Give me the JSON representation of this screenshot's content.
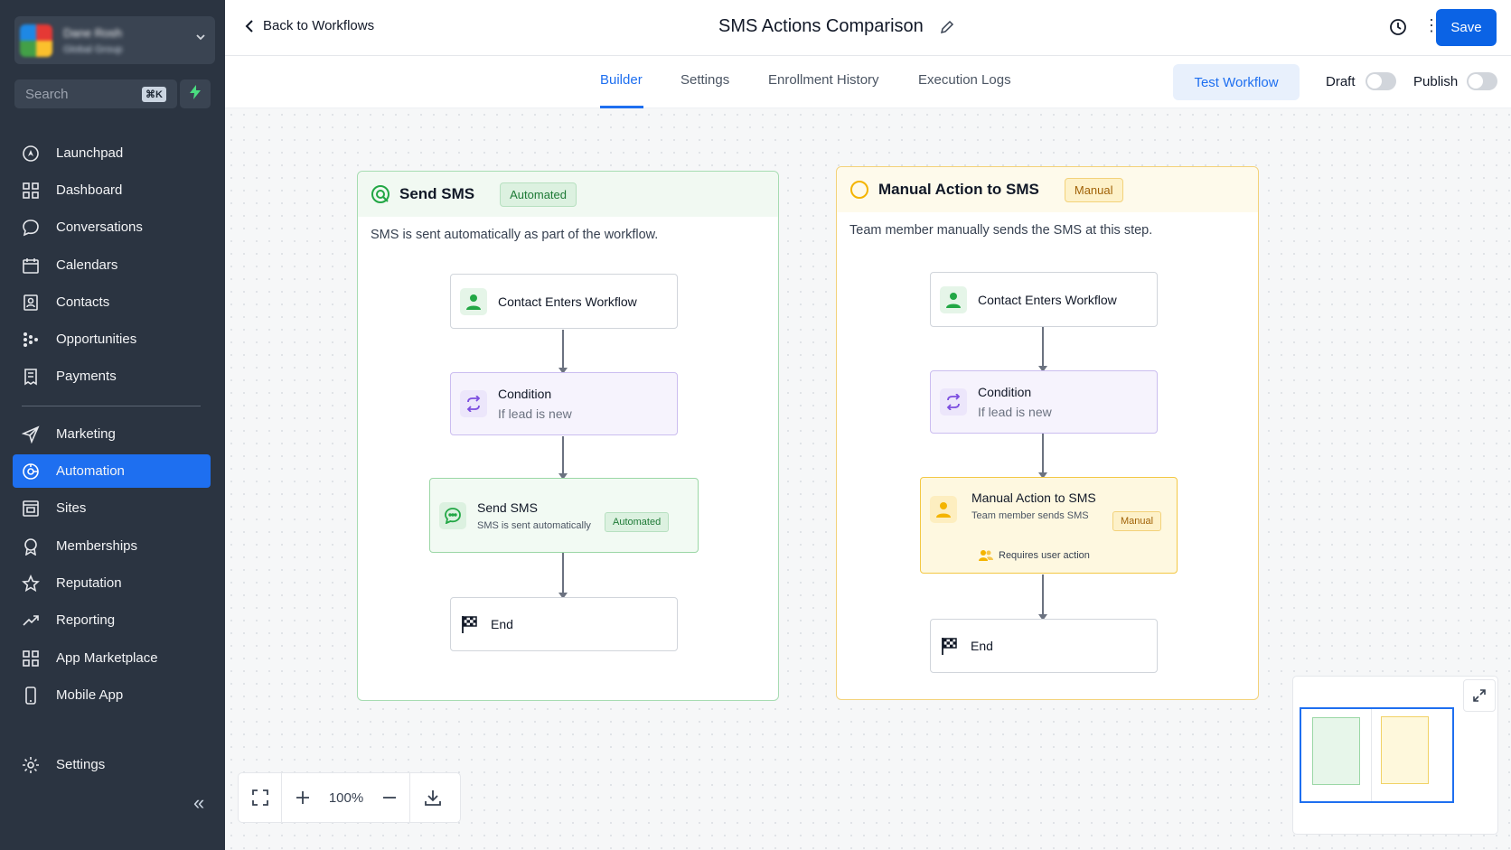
{
  "sidebar": {
    "account": {
      "name": "Dane Rosh",
      "subtitle": "Global Group"
    },
    "search": {
      "placeholder": "Search",
      "shortcut": "⌘K"
    },
    "items": [
      {
        "label": "Launchpad",
        "icon": "rocket-icon"
      },
      {
        "label": "Dashboard",
        "icon": "grid-icon"
      },
      {
        "label": "Conversations",
        "icon": "chat-icon"
      },
      {
        "label": "Calendars",
        "icon": "calendar-icon"
      },
      {
        "label": "Contacts",
        "icon": "contacts-icon"
      },
      {
        "label": "Opportunities",
        "icon": "funnel-icon"
      },
      {
        "label": "Payments",
        "icon": "receipt-icon"
      },
      {
        "label": "Marketing",
        "icon": "send-icon"
      },
      {
        "label": "Automation",
        "icon": "automation-icon",
        "active": true
      },
      {
        "label": "Sites",
        "icon": "sites-icon"
      },
      {
        "label": "Memberships",
        "icon": "badge-icon"
      },
      {
        "label": "Reputation",
        "icon": "star-icon"
      },
      {
        "label": "Reporting",
        "icon": "trend-icon"
      },
      {
        "label": "App Marketplace",
        "icon": "apps-icon"
      },
      {
        "label": "Mobile App",
        "icon": "phone-icon"
      }
    ],
    "settings_label": "Settings"
  },
  "header": {
    "back_label": "Back to Workflows",
    "title": "SMS Actions Comparison",
    "save_label": "Save"
  },
  "tabs": {
    "items": [
      "Builder",
      "Settings",
      "Enrollment History",
      "Execution Logs"
    ],
    "active": "Builder",
    "test_label": "Test Workflow",
    "draft_label": "Draft",
    "publish_label": "Publish"
  },
  "panels": {
    "automated": {
      "title": "Send SMS",
      "badge": "Automated",
      "description": "SMS is sent automatically as part of the workflow.",
      "nodes": {
        "trigger": "Contact Enters Workflow",
        "condition_title": "Condition",
        "condition_sub": "If lead is new",
        "action_title": "Send SMS",
        "action_sub": "SMS is sent automatically",
        "action_badge": "Automated",
        "end": "End"
      }
    },
    "manual": {
      "title": "Manual Action to SMS",
      "badge": "Manual",
      "description": "Team member manually sends the SMS at this step.",
      "nodes": {
        "trigger": "Contact Enters Workflow",
        "condition_title": "Condition",
        "condition_sub": "If lead is new",
        "action_title": "Manual Action to SMS",
        "action_sub": "Team member sends SMS",
        "action_badge": "Manual",
        "action_note": "Requires user action",
        "end": "End"
      }
    }
  },
  "zoom": {
    "level": "100%"
  },
  "colors": {
    "primary": "#1e6ff0",
    "sidebar_bg": "#2b3441",
    "automated_green": "#22a745",
    "manual_amber": "#f4b400"
  }
}
